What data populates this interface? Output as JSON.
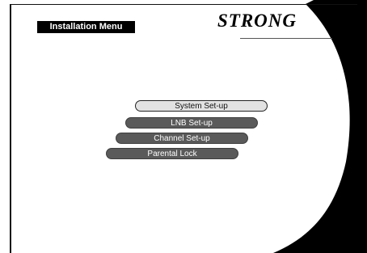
{
  "header": {
    "title": "Installation Menu"
  },
  "logo": {
    "text": "STRONG"
  },
  "menu": {
    "items": [
      {
        "label": "System Set-up",
        "selected": true
      },
      {
        "label": "LNB Set-up",
        "selected": false
      },
      {
        "label": "Channel Set-up",
        "selected": false
      },
      {
        "label": "Parental Lock",
        "selected": false
      }
    ]
  },
  "colors": {
    "background": "#ffffff",
    "sweep": "#000000",
    "item": "#5a5a5a",
    "item_selected": "#e2e2e2"
  }
}
